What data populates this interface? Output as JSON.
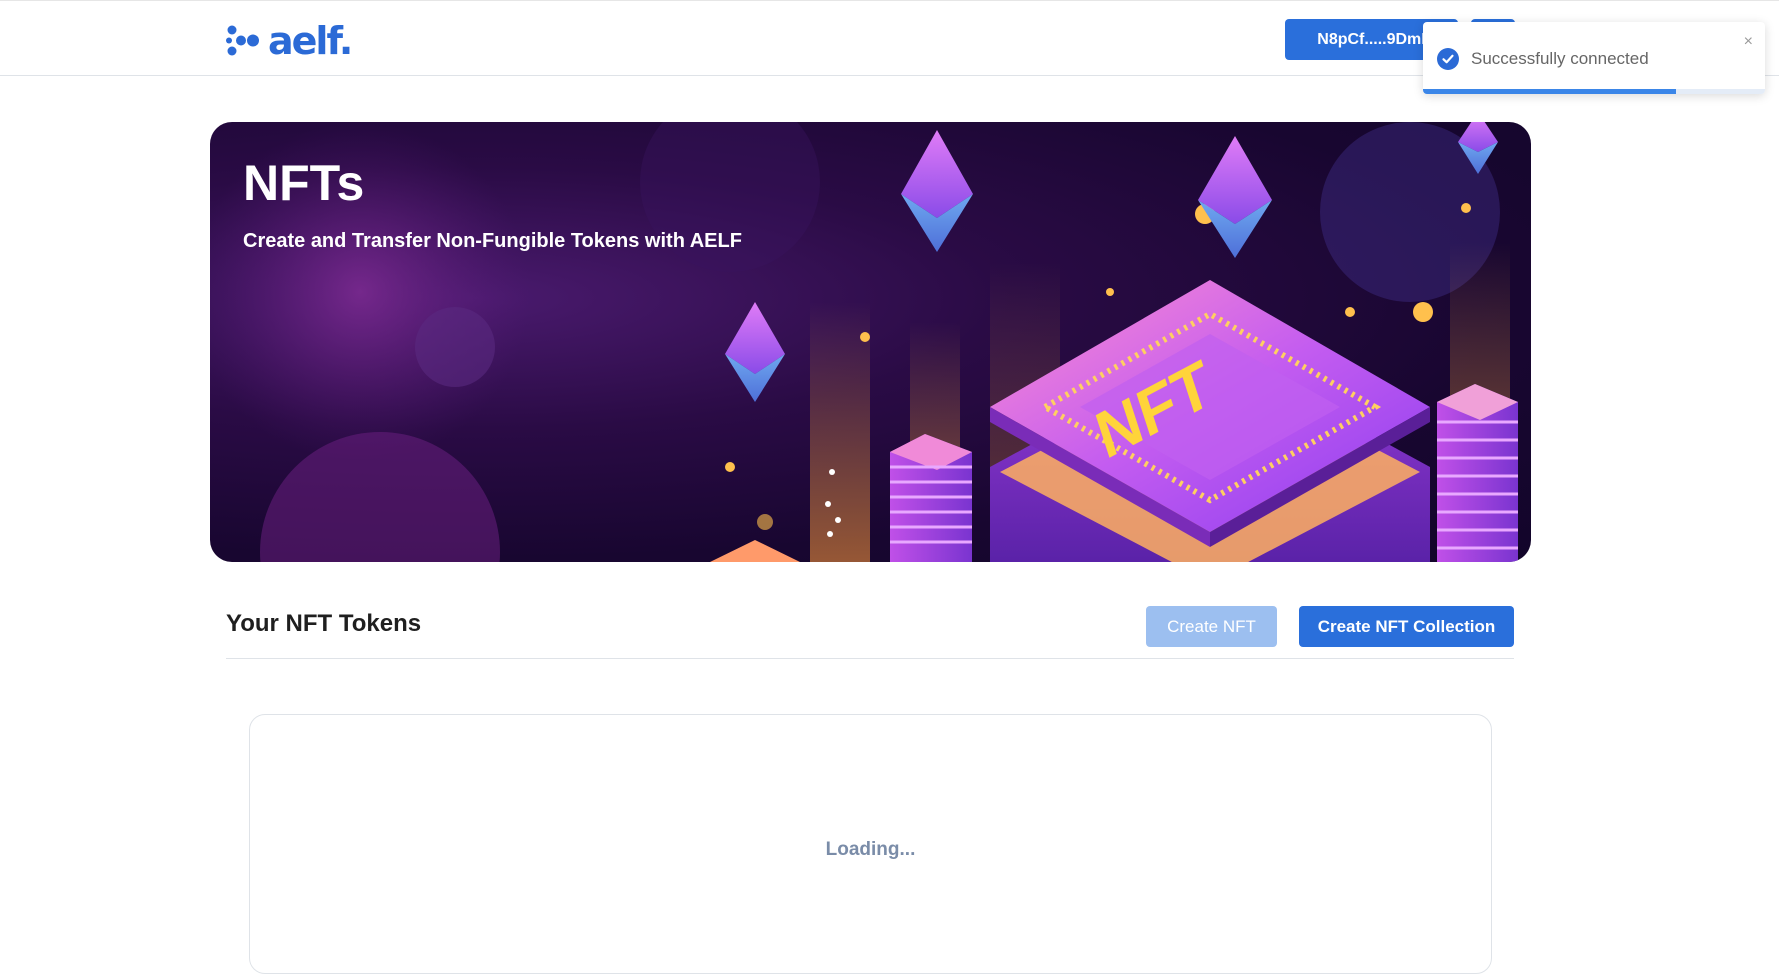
{
  "header": {
    "logo_text": "aelf.",
    "wallet_label": "N8pCf.....9DmI",
    "menu_icon": "menu-icon"
  },
  "toast": {
    "message": "Successfully connected",
    "close_symbol": "×",
    "progress": 0.74,
    "icon": "check-circle-icon"
  },
  "banner": {
    "title": "NFTs",
    "subtitle": "Create and Transfer Non-Fungible Tokens with AELF",
    "chip_text": "NFT"
  },
  "section": {
    "title": "Your NFT Tokens",
    "create_nft_label": "Create NFT",
    "create_collection_label": "Create NFT Collection"
  },
  "content": {
    "loading_text": "Loading..."
  },
  "colors": {
    "primary": "#2a6fdb",
    "primary_disabled": "#9cbff0",
    "banner_dark": "#180630"
  }
}
